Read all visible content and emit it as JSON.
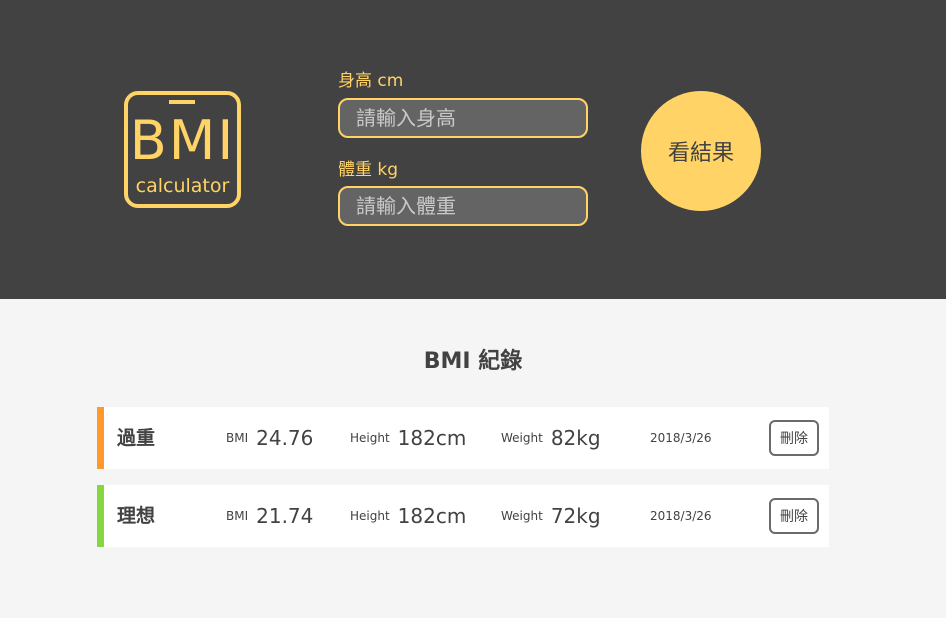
{
  "logo": {
    "word": "BMI",
    "subtitle": "calculator"
  },
  "form": {
    "height_label": "身高 cm",
    "height_placeholder": "請輸入身高",
    "weight_label": "體重 kg",
    "weight_placeholder": "請輸入體重",
    "submit_label": "看結果"
  },
  "records": {
    "title": "BMI 紀錄",
    "items": [
      {
        "status": "過重",
        "status_color": "#ff982d",
        "bmi_label": "BMI",
        "bmi": "24.76",
        "height_label": "Height",
        "height": "182cm",
        "weight_label": "Weight",
        "weight": "82kg",
        "date": "2018/3/26",
        "delete_label": "刪除"
      },
      {
        "status": "理想",
        "status_color": "#86d73f",
        "bmi_label": "BMI",
        "bmi": "21.74",
        "height_label": "Height",
        "height": "182cm",
        "weight_label": "Weight",
        "weight": "72kg",
        "date": "2018/3/26",
        "delete_label": "刪除"
      }
    ]
  },
  "colors": {
    "accent": "#ffd366",
    "header_bg": "#424242",
    "page_bg": "#f5f5f5"
  }
}
